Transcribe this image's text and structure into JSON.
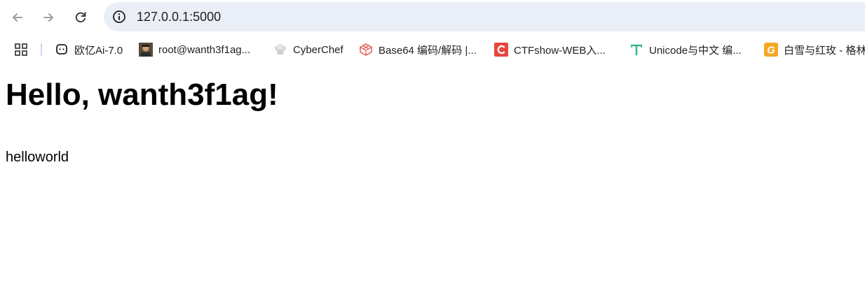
{
  "browser": {
    "address_bar": {
      "url": "127.0.0.1:5000",
      "icon": "info-icon"
    },
    "nav": {
      "back_icon": "arrow-left-icon",
      "forward_icon": "arrow-right-icon",
      "reload_icon": "reload-icon"
    },
    "bookmarks": [
      {
        "label": "欧亿Ai-7.0",
        "icon": "chat-bubble-icon"
      },
      {
        "label": "root@wanth3f1ag...",
        "icon": "avatar-icon"
      },
      {
        "label": "CyberChef",
        "icon": "chef-hat-icon"
      },
      {
        "label": "Base64 编码/解码 |...",
        "icon": "cube-icon"
      },
      {
        "label": "CTFshow-WEB入...",
        "icon": "c-logo-icon"
      },
      {
        "label": "Unicode与中文 编...",
        "icon": "t-logo-icon"
      },
      {
        "label": "白雪与红玫 - 格林",
        "icon": "g-logo-icon"
      }
    ]
  },
  "page": {
    "heading": "Hello, wanth3f1ag!",
    "body_text": "helloworld"
  },
  "colors": {
    "omnibox_bg": "#eaeef7",
    "ctf_red": "#e8453c",
    "base64_red": "#e05a4e",
    "unicode_green": "#3db48a",
    "g_orange": "#f5a623"
  }
}
